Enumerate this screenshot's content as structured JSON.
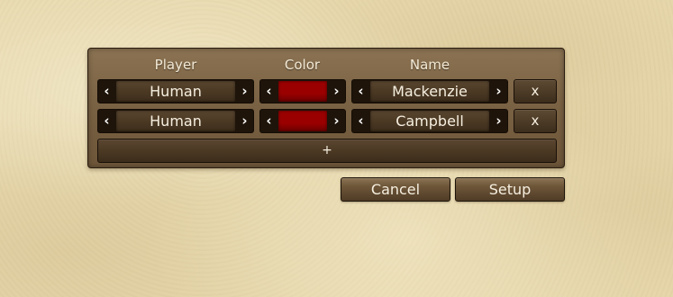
{
  "headers": {
    "player": "Player",
    "color": "Color",
    "name": "Name"
  },
  "arrows": {
    "left": "‹",
    "right": "›"
  },
  "players": [
    {
      "type": "Human",
      "color": "#9b0000",
      "name": "Mackenzie",
      "remove_label": "x"
    },
    {
      "type": "Human",
      "color": "#9b0000",
      "name": "Campbell",
      "remove_label": "x"
    }
  ],
  "add_player_label": "+",
  "buttons": {
    "cancel": "Cancel",
    "setup": "Setup"
  },
  "colors": {
    "background": "#e8d9ae",
    "panel": "#7a6244",
    "selector_dark": "#1e140a",
    "text": "#f6efe0"
  }
}
